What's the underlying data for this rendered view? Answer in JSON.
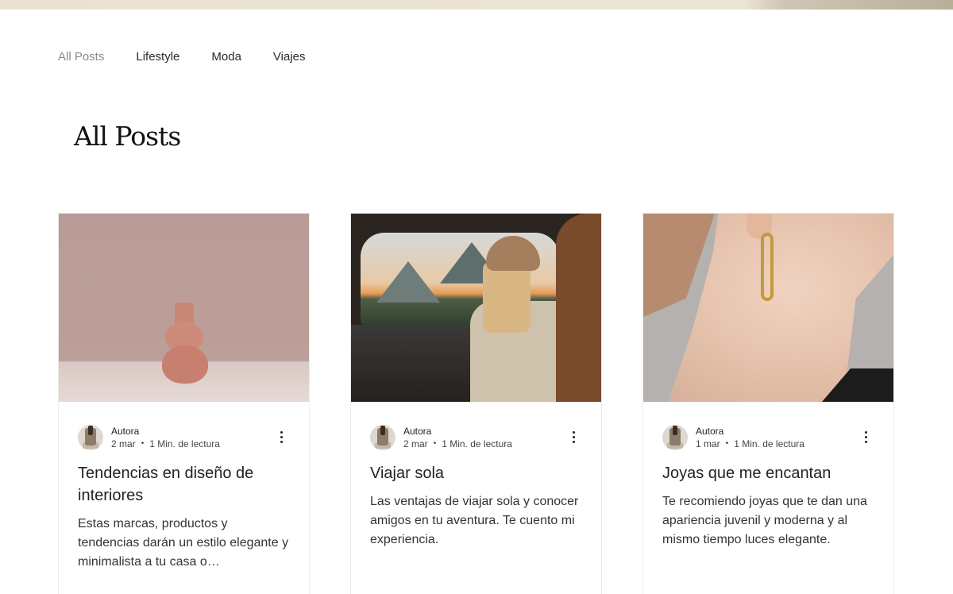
{
  "nav": {
    "categories": [
      "All Posts",
      "Lifestyle",
      "Moda",
      "Viajes"
    ],
    "active_index": 0
  },
  "page_title": "All Posts",
  "posts": [
    {
      "author": "Autora",
      "date": "2 mar",
      "read_time": "1 Min. de lectura",
      "title": "Tendencias en diseño de interiores",
      "excerpt": "Estas marcas, productos y tendencias darán un estilo elegante y minimalista a tu casa o…",
      "image_icon": "vase-photo"
    },
    {
      "author": "Autora",
      "date": "2 mar",
      "read_time": "1 Min. de lectura",
      "title": "Viajar sola",
      "excerpt": "Las ventajas de viajar sola y conocer amigos en tu aventura. Te cuento mi experiencia.",
      "image_icon": "travel-car-photo"
    },
    {
      "author": "Autora",
      "date": "1 mar",
      "read_time": "1 Min. de lectura",
      "title": "Joyas que me encantan",
      "excerpt": "Te recomiendo joyas que te dan una apariencia juvenil y moderna y al mismo tiempo luces elegante.",
      "image_icon": "earring-photo"
    }
  ],
  "colors": {
    "active_category": "#8a8a8a",
    "text": "#222222",
    "card_border": "#ececec",
    "accent_gold": "#c49a3c"
  }
}
